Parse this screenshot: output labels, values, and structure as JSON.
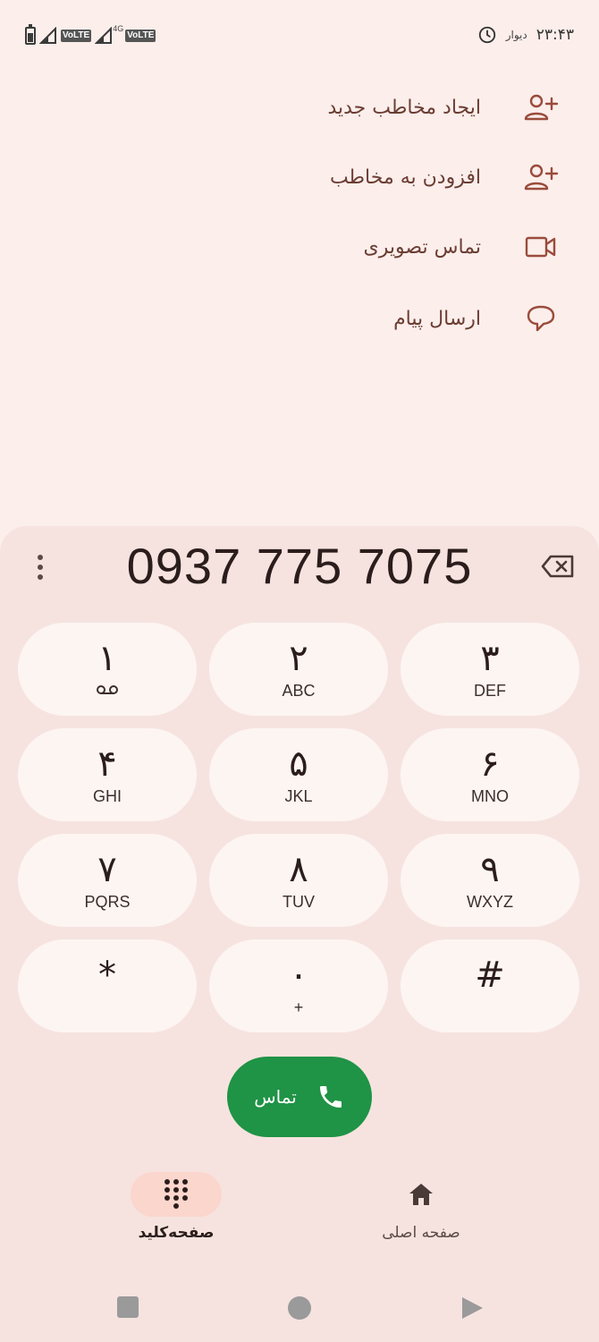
{
  "status_bar": {
    "time": "۲۳:۴۳",
    "carrier": "دیوار",
    "volte_1": "VoLTE",
    "network_type": "4G",
    "volte_2": "VoLTE"
  },
  "menu": [
    {
      "label": "ایجاد مخاطب جدید",
      "icon": "add-person-icon"
    },
    {
      "label": "افزودن به مخاطب",
      "icon": "add-person-icon"
    },
    {
      "label": "تماس تصویری",
      "icon": "video-camera-icon"
    },
    {
      "label": "ارسال پیام",
      "icon": "message-bubble-icon"
    }
  ],
  "dialer": {
    "number": "0937 775 7075",
    "keys": [
      {
        "digit": "۱",
        "letters": ""
      },
      {
        "digit": "۲",
        "letters": "ABC"
      },
      {
        "digit": "۳",
        "letters": "DEF"
      },
      {
        "digit": "۴",
        "letters": "GHI"
      },
      {
        "digit": "۵",
        "letters": "JKL"
      },
      {
        "digit": "۶",
        "letters": "MNO"
      },
      {
        "digit": "۷",
        "letters": "PQRS"
      },
      {
        "digit": "۸",
        "letters": "TUV"
      },
      {
        "digit": "۹",
        "letters": "WXYZ"
      },
      {
        "digit": "*",
        "letters": ""
      },
      {
        "digit": "۰",
        "letters": "+"
      },
      {
        "digit": "#",
        "letters": ""
      }
    ],
    "call_label": "تماس"
  },
  "bottom_nav": {
    "keypad_label": "صفحه‌کلید",
    "home_label": "صفحه اصلی"
  },
  "colors": {
    "background": "#fbeeeb",
    "sheet": "#f6e3df",
    "key": "#fdf5f2",
    "call_green": "#1f9346",
    "accent_icon": "#9a4b3b",
    "active_pill": "#fbd6cd"
  }
}
